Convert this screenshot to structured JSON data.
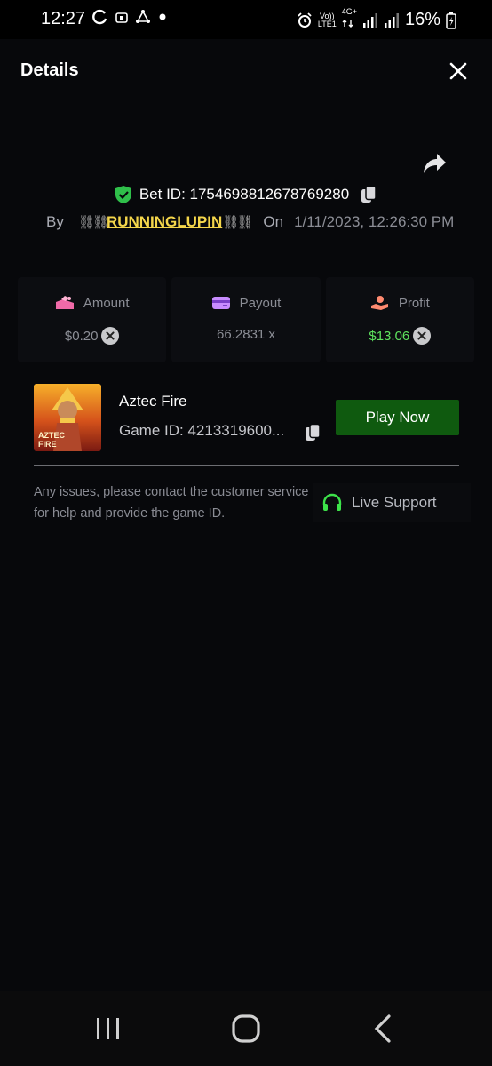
{
  "status_bar": {
    "time": "12:27",
    "volte_label": "Vo))",
    "lte_label": "LTE1",
    "network_label": "4G+",
    "battery_percent": "16%"
  },
  "header": {
    "title": "Details"
  },
  "bet": {
    "id_label": "Bet ID: 1754698812678769280",
    "by_label": "By",
    "username": "RUNNINGLUPIN",
    "on_label": "On",
    "datetime": "1/11/2023, 12:26:30 PM"
  },
  "stats": {
    "amount": {
      "label": "Amount",
      "value": "$0.20"
    },
    "payout": {
      "label": "Payout",
      "value": "66.2831 x"
    },
    "profit": {
      "label": "Profit",
      "value": "$13.06"
    }
  },
  "game": {
    "name": "Aztec Fire",
    "id_text": "Game ID: 4213319600...",
    "thumb_text": "AZTEC FIRE",
    "play_label": "Play Now",
    "help_text": "Any issues, please contact the customer service for help and provide the game ID.",
    "support_label": "Live Support"
  },
  "colors": {
    "background": "#07080b",
    "accent_green": "#0f5a0f",
    "profit_green": "#5ee45e",
    "username_yellow": "#f4d64b",
    "shield_green": "#2fbf4a"
  }
}
